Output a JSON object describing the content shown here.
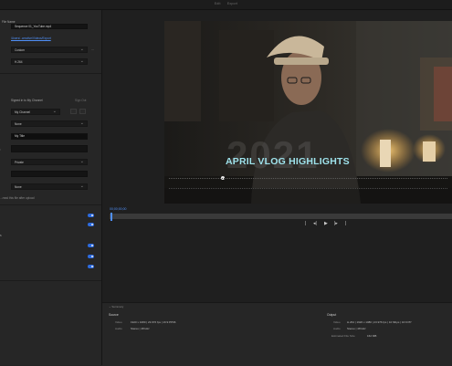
{
  "titlebar": {
    "tabs": [
      "Edit",
      "Export"
    ]
  },
  "settings": {
    "file_name": "Sequence 01_YouTube.mp4",
    "location_link": "/Users/..creative/Videos/Export",
    "preset": "Custom",
    "preset_more": "...",
    "format": "H.264",
    "account_label": "Signed in to My Channel",
    "sign_out": "Sign Out",
    "channel": "My Channel",
    "playlist": "None",
    "title": "My Title",
    "privacy": "Private",
    "category": "None",
    "note": "...read this file after upload",
    "toggles": [
      "",
      "",
      "",
      "",
      ""
    ]
  },
  "video": {
    "headline": "APRIL VLOG HIGHLIGHTS",
    "year": "2021"
  },
  "playback": {
    "timecode": "00;00;00;00",
    "controls": [
      "|",
      "◂|",
      "▶",
      "|▸",
      "|"
    ]
  },
  "summary": {
    "header": "Summary",
    "source": {
      "title": "Source",
      "video_label": "Video",
      "video_value": "1920 x 1080 | 23.976 fps | 16:9 PP96",
      "audio_label": "Audio",
      "audio_value": "Stereo | 48 kHz"
    },
    "output": {
      "title": "Output",
      "video_label": "Video",
      "video_value": "H.264 | 1920 x 1080 | 23.976 fps | 10 Mbps | 16:9 PP",
      "audio_label": "Audio",
      "audio_value": "Stereo | 48 kHz",
      "size_label": "Estimated File Size",
      "size_value": "162 MB"
    }
  },
  "colors": {
    "accent": "#4f8ff7",
    "toggle": "#2d6be0",
    "headline": "#9fe3ec"
  }
}
